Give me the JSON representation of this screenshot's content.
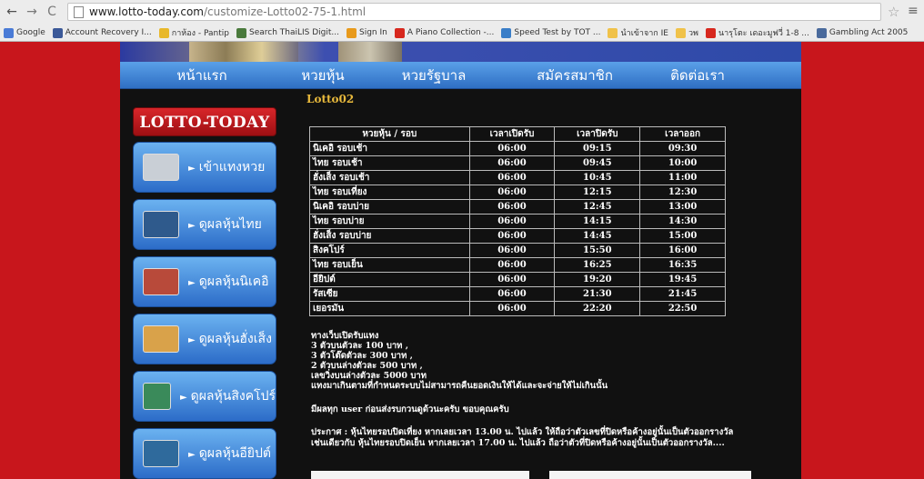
{
  "browser": {
    "url_domain": "www.lotto-today.com",
    "url_path": "/customize-Lotto02-75-1.html",
    "bookmarks": [
      {
        "label": "Google",
        "color": "#4a7bd6"
      },
      {
        "label": "Account Recovery I...",
        "color": "#3b5998"
      },
      {
        "label": "กาห้อง - Pantip",
        "color": "#e8b82a"
      },
      {
        "label": "Search ThaiLIS Digit...",
        "color": "#4a7a3c"
      },
      {
        "label": "Sign In",
        "color": "#e89a1c"
      },
      {
        "label": "A Piano Collection -...",
        "color": "#d7281e"
      },
      {
        "label": "Speed Test by TOT ...",
        "color": "#3a7ec8"
      },
      {
        "label": "นำเข้าจาก IE",
        "color": "#f0c24a"
      },
      {
        "label": "วพ",
        "color": "#f0c24a"
      },
      {
        "label": "นารุโตะ เดอะมูฟวี่ 1-8 ...",
        "color": "#d7281e"
      },
      {
        "label": "Gambling Act 2005",
        "color": "#4a6a9c"
      }
    ]
  },
  "nav": {
    "items": [
      "หน้าแรก",
      "หวยหุ้น",
      "หวยรัฐบาล",
      "สมัครสมาชิก",
      "ติดต่อเรา"
    ]
  },
  "sidebar": {
    "logo": "LOTTO-TODAY",
    "items": [
      {
        "label": "เข้าแทงหวย",
        "thumb": "#c9cfd6"
      },
      {
        "label": "ดูผลหุ้นไทย",
        "thumb": "#2f5a8c"
      },
      {
        "label": "ดูผลหุ้นนิเคอิ",
        "thumb": "#b84a3a"
      },
      {
        "label": "ดูผลหุ้นฮั่งเส็ง",
        "thumb": "#d9a24a"
      },
      {
        "label": "ดูผลหุ้นสิงคโปร์",
        "thumb": "#3a8a5a"
      },
      {
        "label": "ดูผลหุ้นอียิปต์",
        "thumb": "#2f6a9c"
      }
    ]
  },
  "content": {
    "title": "Lotto02",
    "table": {
      "headers": [
        "หวยหุ้น / รอบ",
        "เวลาเปิดรับ",
        "เวลาปิดรับ",
        "เวลาออก"
      ],
      "rows": [
        [
          "นิเคอิ รอบเช้า",
          "06:00",
          "09:15",
          "09:30"
        ],
        [
          "ไทย รอบเช้า",
          "06:00",
          "09:45",
          "10:00"
        ],
        [
          "ฮั่งเส็ง รอบเช้า",
          "06:00",
          "10:45",
          "11:00"
        ],
        [
          "ไทย รอบเที่ยง",
          "06:00",
          "12:15",
          "12:30"
        ],
        [
          "นิเคอิ รอบบ่าย",
          "06:00",
          "12:45",
          "13:00"
        ],
        [
          "ไทย รอบบ่าย",
          "06:00",
          "14:15",
          "14:30"
        ],
        [
          "ฮั่งเส็ง รอบบ่าย",
          "06:00",
          "14:45",
          "15:00"
        ],
        [
          "สิงคโปร์",
          "06:00",
          "15:50",
          "16:00"
        ],
        [
          "ไทย รอบเย็น",
          "06:00",
          "16:25",
          "16:35"
        ],
        [
          "อียิปต์",
          "06:00",
          "19:20",
          "19:45"
        ],
        [
          "รัสเซีย",
          "06:00",
          "21:30",
          "21:45"
        ],
        [
          "เยอรมัน",
          "06:00",
          "22:20",
          "22:50"
        ]
      ]
    },
    "info_lines": [
      "ทางเว็บเปิดรับแทง",
      "3 ตัวบนตัวละ 100 บาท ,",
      "3 ตัวโต๊ดตัวละ 300 บาท ,",
      "2 ตัวบนล่างตัวละ 500 บาท ,",
      "เลขวิ่งบนล่างตัวละ 5000 บาท",
      "แทงมาเกินตามที่กำหนดระบบไม่สามารถคืนยอดเงินให้ได้และจะจ่ายให้ไม่เกินนั้น"
    ],
    "notice_user": "มีผลทุก user ก่อนส่งรบกวนดูด้วนะครับ ขอบคุณครับ",
    "announce_1": "ประกาศ : หุ้นไทยรอบปิดเที่ยง หากเลยเวลา 13.00 น. ไปแล้ว ให้ถือว่าตัวเลขที่ปิดหรือค้างอยู่นั้นเป็นตัวออกรางวัล",
    "announce_2": "เช่นเดียวกับ หุ้นไทยรอบปิดเย็น หากเลยเวลา 17.00 น. ไปแล้ว ถือว่าตัวที่ปิดหรือค้างอยู่นั้นเป็นตัวออกรางวัล...."
  }
}
